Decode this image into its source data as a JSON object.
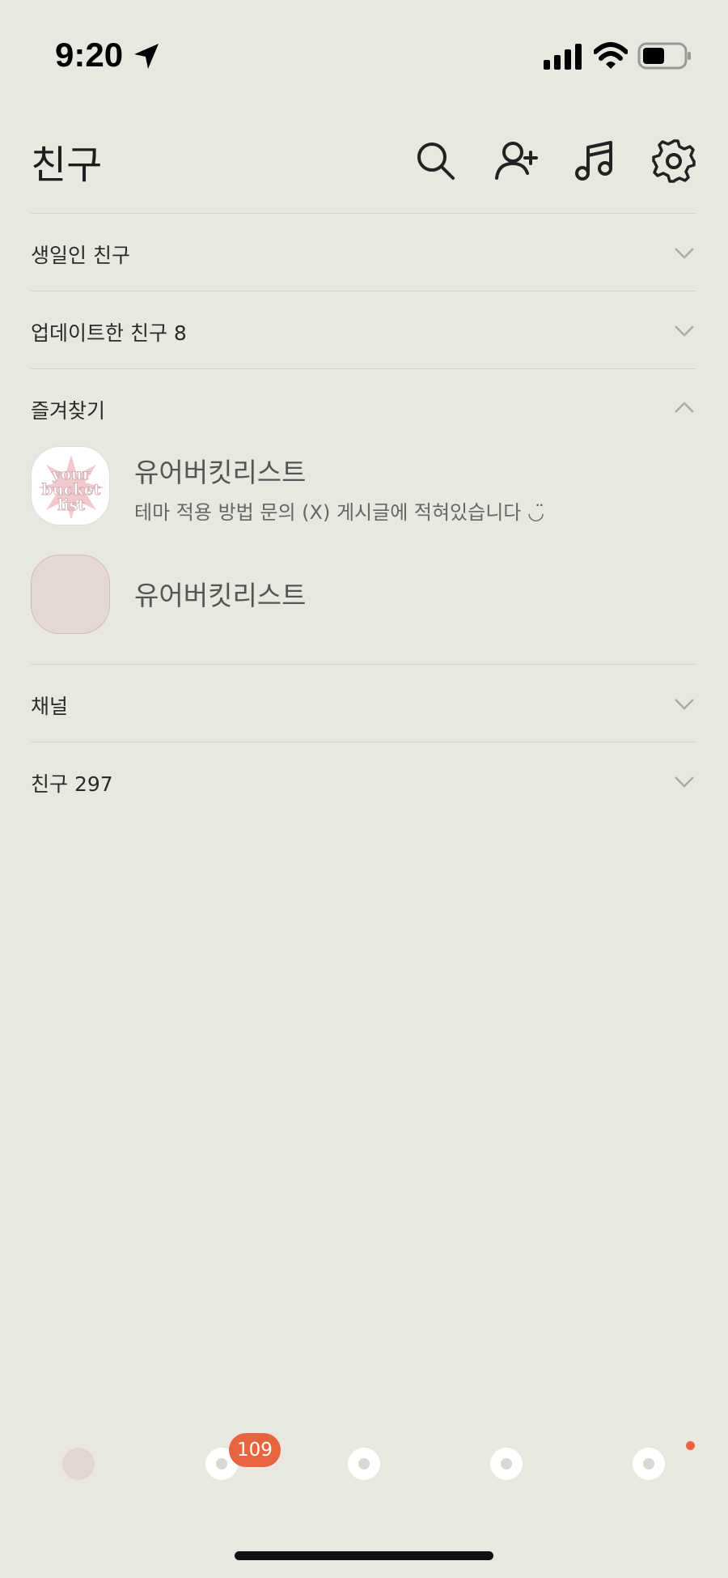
{
  "status_bar": {
    "time": "9:20"
  },
  "header": {
    "title": "친구",
    "icons": [
      "search-icon",
      "add-friend-icon",
      "music-icon",
      "settings-icon"
    ]
  },
  "sections": {
    "birthday": {
      "label": "생일인 친구"
    },
    "updated": {
      "label": "업데이트한 친구 8"
    },
    "favorites": {
      "label": "즐겨찾기",
      "items": [
        {
          "name": "유어버킷리스트",
          "status": "테마 적용 방법 문의 (X) 게시글에 적혀있습니다 ◡̈",
          "avatar_text": "your bucket list"
        },
        {
          "name": "유어버킷리스트"
        }
      ]
    },
    "channels": {
      "label": "채널"
    },
    "friends": {
      "label": "친구 297"
    }
  },
  "tab_bar": {
    "chats_badge": "109"
  },
  "colors": {
    "background": "#e9e8e0",
    "accent": "#e8643f",
    "avatar_placeholder": "#e5d8d2"
  }
}
